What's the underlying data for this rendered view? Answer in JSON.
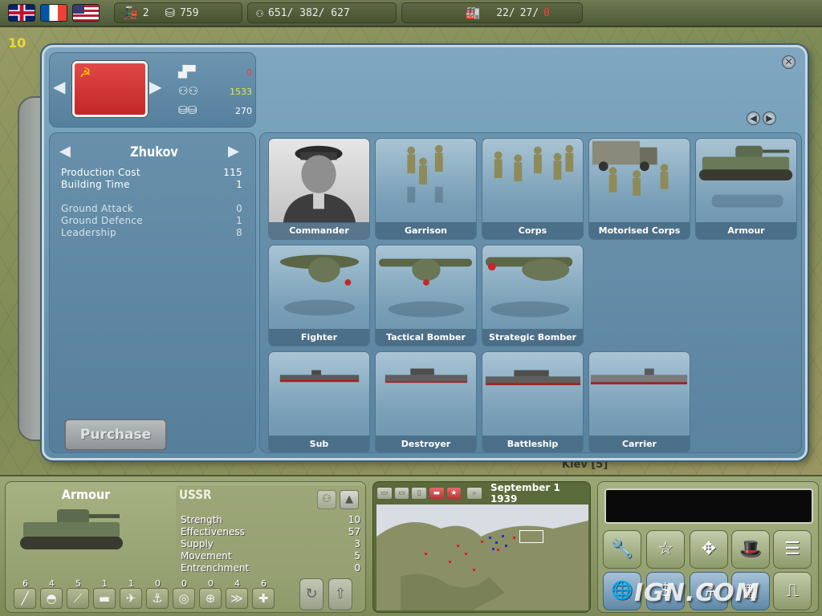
{
  "topbar": {
    "flags": [
      "uk-flag",
      "france-flag",
      "usa-flag"
    ],
    "trains": "2",
    "money": "759",
    "manpower": "651/ 382/ 627",
    "industry_a": "22/",
    "industry_b": "27/",
    "industry_c": "0"
  },
  "map_labels": {
    "left_number": "10",
    "kiev": "Kiev [5]"
  },
  "nation": {
    "industry": "0",
    "manpower": "1533",
    "money": "270"
  },
  "unit_info": {
    "name": "Zhukov",
    "stats": [
      {
        "label": "Production Cost",
        "value": "115"
      },
      {
        "label": "Building Time",
        "value": "1"
      }
    ],
    "combat": [
      {
        "label": "Ground Attack",
        "value": "0"
      },
      {
        "label": "Ground Defence",
        "value": "1"
      },
      {
        "label": "Leadership",
        "value": "8"
      }
    ],
    "purchase_label": "Purchase"
  },
  "units": [
    "Commander",
    "Garrison",
    "Corps",
    "Motorised Corps",
    "Armour",
    "Fighter",
    "Tactical Bomber",
    "Strategic Bomber",
    "Sub",
    "Destroyer",
    "Battleship",
    "Carrier"
  ],
  "bottom": {
    "unit_title": "Armour",
    "nation": "USSR",
    "stats": [
      {
        "label": "Strength",
        "value": "10"
      },
      {
        "label": "Effectiveness",
        "value": "57"
      },
      {
        "label": "Supply",
        "value": "3"
      },
      {
        "label": "Movement",
        "value": "5"
      },
      {
        "label": "Entrenchment",
        "value": "0"
      }
    ],
    "counts": [
      "6",
      "4",
      "5",
      "1",
      "1",
      "0",
      "0",
      "0",
      "4",
      "6"
    ],
    "date": "September 1 1939"
  },
  "watermark": "IGN.COM"
}
